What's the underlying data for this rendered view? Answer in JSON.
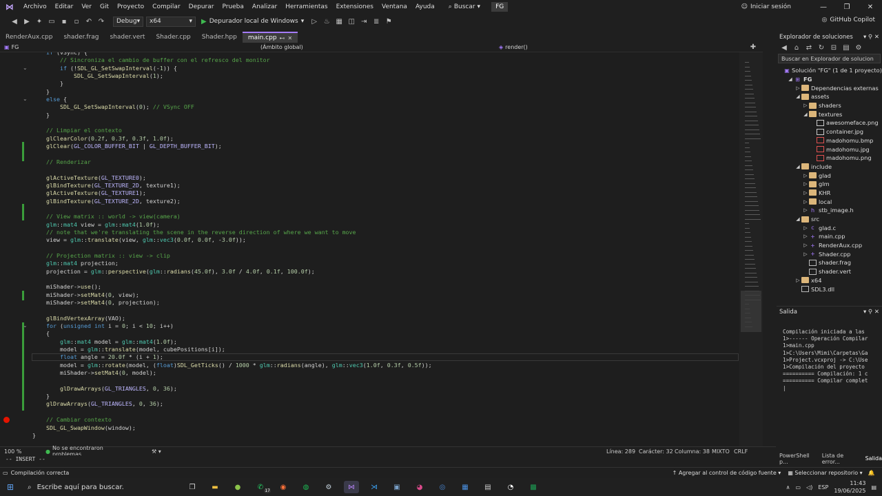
{
  "menu": [
    "Archivo",
    "Editar",
    "Ver",
    "Git",
    "Proyecto",
    "Compilar",
    "Depurar",
    "Prueba",
    "Analizar",
    "Herramientas",
    "Extensiones",
    "Ventana",
    "Ayuda"
  ],
  "search_label": "Buscar",
  "project_badge": "FG",
  "login": "Iniciar sesión",
  "copilot": "GitHub Copilot",
  "toolbar": {
    "config": "Debug",
    "platform": "x64",
    "run": "Depurador local de Windows"
  },
  "tabs": [
    {
      "label": "RenderAux.cpp",
      "active": false
    },
    {
      "label": "shader.frag",
      "active": false
    },
    {
      "label": "shader.vert",
      "active": false
    },
    {
      "label": "Shader.cpp",
      "active": false
    },
    {
      "label": "Shader.hpp",
      "active": false
    },
    {
      "label": "main.cpp",
      "active": true
    }
  ],
  "nav": {
    "project": "FG",
    "scope": "(Ámbito global)",
    "member": "render()"
  },
  "code": [
    "    if (vSync) {",
    "        // Sincroniza el cambio de buffer con el refresco del monitor",
    "        if (!SDL_GL_SetSwapInterval(-1)) {",
    "            SDL_GL_SetSwapInterval(1);",
    "        }",
    "    }",
    "    else {",
    "        SDL_GL_SetSwapInterval(0); // VSync OFF",
    "    }",
    "",
    "    // Limpiar el contexto",
    "    glClearColor(0.2f, 0.3f, 0.3f, 1.0f);",
    "    glClear(GL_COLOR_BUFFER_BIT | GL_DEPTH_BUFFER_BIT);",
    "",
    "    // Renderizar",
    "",
    "    glActiveTexture(GL_TEXTURE0);",
    "    glBindTexture(GL_TEXTURE_2D, texture1);",
    "    glActiveTexture(GL_TEXTURE1);",
    "    glBindTexture(GL_TEXTURE_2D, texture2);",
    "",
    "    // View matrix :: world -> view(camera)",
    "    glm::mat4 view = glm::mat4(1.0f);",
    "    // note that we're translating the scene in the reverse direction of where we want to move",
    "    view = glm::translate(view, glm::vec3(0.0f, 0.0f, -3.0f));",
    "",
    "    // Projection matrix :: view -> clip",
    "    glm::mat4 projection;",
    "    projection = glm::perspective(glm::radians(45.0f), 3.0f / 4.0f, 0.1f, 100.0f);",
    "",
    "    miShader->use();",
    "    miShader->setMat4(\"view\", view);",
    "    miShader->setMat4(\"projection\", projection);",
    "",
    "    glBindVertexArray(VAO);",
    "    for (unsigned int i = 0; i < 10; i++)",
    "    {",
    "        glm::mat4 model = glm::mat4(1.0f);",
    "        model = glm::translate(model, cubePositions[i]);",
    "        float angle = 20.0f * (i + 1);",
    "        model = glm::rotate(model, (float)SDL_GetTicks() / 1000 * glm::radians(angle), glm::vec3(1.0f, 0.3f, 0.5f));",
    "        miShader->setMat4(\"model\", model);",
    "",
    "        glDrawArrays(GL_TRIANGLES, 0, 36);",
    "    }",
    "    glDrawArrays(GL_TRIANGLES, 0, 36);",
    "",
    "    // Cambiar contexto",
    "    SDL_GL_SwapWindow(window);",
    "}"
  ],
  "editor_status": {
    "zoom": "100 %",
    "problems": "No se encontraron problemas.",
    "line": "Línea: 289",
    "char": "Carácter: 32",
    "col": "Columna: 38",
    "eol": "MIXTO",
    "crlf": "CRLF"
  },
  "insert_mode": "-- INSERT --",
  "solution": {
    "title": "Explorador de soluciones",
    "search_placeholder": "Buscar en Explorador de solucion",
    "items": [
      {
        "label": "Solución \"FG\" (1 de 1 proyecto)",
        "depth": 0,
        "arrow": "",
        "icon": "solution"
      },
      {
        "label": "FG",
        "depth": 1,
        "arrow": "◢",
        "icon": "project",
        "bold": true
      },
      {
        "label": "Dependencias externas",
        "depth": 2,
        "arrow": "▷",
        "icon": "folder"
      },
      {
        "label": "assets",
        "depth": 2,
        "arrow": "◢",
        "icon": "folder"
      },
      {
        "label": "shaders",
        "depth": 3,
        "arrow": "▷",
        "icon": "folder"
      },
      {
        "label": "textures",
        "depth": 3,
        "arrow": "◢",
        "icon": "folder"
      },
      {
        "label": "awesomeface.png",
        "depth": 4,
        "arrow": "",
        "icon": "img"
      },
      {
        "label": "container.jpg",
        "depth": 4,
        "arrow": "",
        "icon": "img"
      },
      {
        "label": "madohomu.bmp",
        "depth": 4,
        "arrow": "",
        "icon": "img-red"
      },
      {
        "label": "madohomu.jpg",
        "depth": 4,
        "arrow": "",
        "icon": "img-red"
      },
      {
        "label": "madohomu.png",
        "depth": 4,
        "arrow": "",
        "icon": "img-red"
      },
      {
        "label": "include",
        "depth": 2,
        "arrow": "◢",
        "icon": "folder"
      },
      {
        "label": "glad",
        "depth": 3,
        "arrow": "▷",
        "icon": "folder"
      },
      {
        "label": "glm",
        "depth": 3,
        "arrow": "▷",
        "icon": "folder"
      },
      {
        "label": "KHR",
        "depth": 3,
        "arrow": "▷",
        "icon": "folder"
      },
      {
        "label": "local",
        "depth": 3,
        "arrow": "▷",
        "icon": "folder"
      },
      {
        "label": "stb_image.h",
        "depth": 3,
        "arrow": "▷",
        "icon": "h"
      },
      {
        "label": "src",
        "depth": 2,
        "arrow": "◢",
        "icon": "folder"
      },
      {
        "label": "glad.c",
        "depth": 3,
        "arrow": "▷",
        "icon": "c"
      },
      {
        "label": "main.cpp",
        "depth": 3,
        "arrow": "▷",
        "icon": "cpp"
      },
      {
        "label": "RenderAux.cpp",
        "depth": 3,
        "arrow": "▷",
        "icon": "cpp"
      },
      {
        "label": "Shader.cpp",
        "depth": 3,
        "arrow": "▷",
        "icon": "cpp"
      },
      {
        "label": "shader.frag",
        "depth": 3,
        "arrow": "",
        "icon": "shader"
      },
      {
        "label": "shader.vert",
        "depth": 3,
        "arrow": "",
        "icon": "shader"
      },
      {
        "label": "x64",
        "depth": 2,
        "arrow": "▷",
        "icon": "folder"
      },
      {
        "label": "SDL3.dll",
        "depth": 2,
        "arrow": "",
        "icon": "dll"
      }
    ]
  },
  "output": {
    "title": "Salida",
    "lines": [
      "Compilación iniciada a las",
      "1>------ Operación Compilar",
      "1>main.cpp",
      "1>C:\\Users\\Mimi\\Carpetas\\Ga",
      "1>Project.vcxproj -> C:\\Use",
      "1>Compilación del proyecto",
      "========== Compilación: 1 c",
      "========== Compilar complet",
      "|"
    ]
  },
  "bottom_tabs": [
    "PowerShell p...",
    "Lista de error...",
    "Salida"
  ],
  "status": {
    "left": "Compilación correcta",
    "git": "Agregar al control de código fuente",
    "repo": "Seleccionar repositorio"
  },
  "taskbar": {
    "search_placeholder": "Escribe aquí para buscar.",
    "lang": "ESP",
    "time": "11:43",
    "date": "19/06/2025",
    "badge": "17"
  },
  "colors": {
    "accent": "#a57bff",
    "ok": "#3fb950",
    "breakpoint": "#e51400"
  }
}
